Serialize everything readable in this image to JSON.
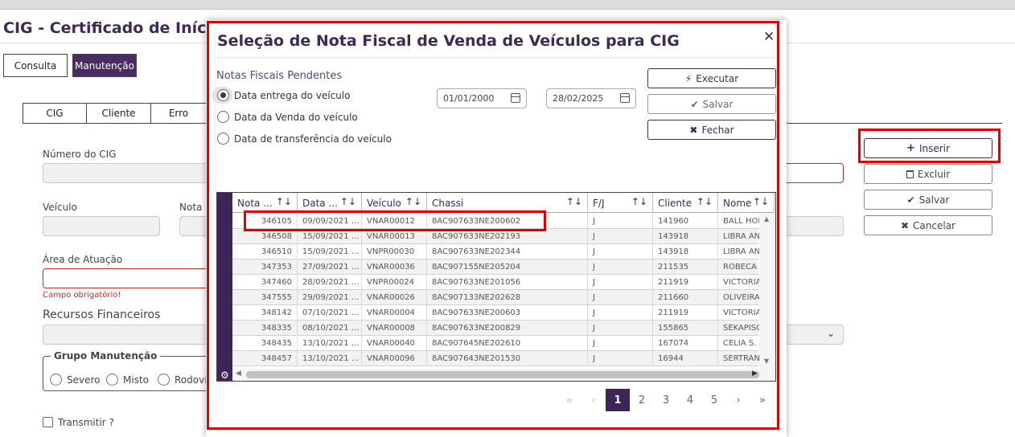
{
  "app": {
    "title": "CIG - Certificado de Início de",
    "tabs": [
      "Consulta",
      "Manutenção"
    ],
    "subtabs": [
      "CIG",
      "Cliente",
      "Erro"
    ],
    "labels": {
      "numero_cig": "Número do CIG",
      "veiculo": "Veículo",
      "nota": "Nota F",
      "area": "Área de Atuação",
      "campo_obrigatorio": "Campo obrigatório!",
      "recursos": "Recursos Financeiros",
      "grupo": "Grupo Manutenção",
      "transmitir": "Transmitir ?"
    },
    "grupo_options": [
      "Severo",
      "Misto",
      "Rodovi"
    ],
    "side_buttons": {
      "inserir": "Inserir",
      "excluir": "Excluir",
      "salvar": "Salvar",
      "cancelar": "Cancelar"
    }
  },
  "modal": {
    "title": "Seleção de Nota Fiscal de Venda de Veículos para CIG",
    "section_label": "Notas Fiscais Pendentes",
    "radio_options": [
      "Data entrega do veículo",
      "Data da Venda do veículo",
      "Data de transferência do veículo"
    ],
    "selected_option": "Data entrega do veículo",
    "date_from": "01/01/2000",
    "date_to": "28/02/2025",
    "buttons": {
      "executar": "Executar",
      "salvar": "Salvar",
      "fechar": "Fechar"
    },
    "columns": [
      "Nota ...",
      "Data ...",
      "Veículo",
      "Chassi",
      "F/J",
      "Cliente",
      "Nome"
    ],
    "rows": [
      [
        "346105",
        "09/09/2021 ...",
        "VNAR00012",
        "8AC907633NE200602",
        "J",
        "141960",
        "BALL HORT"
      ],
      [
        "346508",
        "15/09/2021 ...",
        "VNAR00013",
        "8AC907633NE202193",
        "J",
        "143918",
        "LIBRA AND"
      ],
      [
        "346510",
        "15/09/2021 ...",
        "VNPR00030",
        "8AC907633NE202344",
        "J",
        "143918",
        "LIBRA AND"
      ],
      [
        "347353",
        "27/09/2021 ...",
        "VNAR00036",
        "8AC907155NE205204",
        "J",
        "211535",
        "ROBECA P."
      ],
      [
        "347460",
        "28/09/2021 ...",
        "VNPR00024",
        "8AC907633NE201056",
        "J",
        "211919",
        "VICTORIA S"
      ],
      [
        "347555",
        "29/09/2021 ...",
        "VNAR00026",
        "8AC907133NE202628",
        "J",
        "211660",
        "OLIVEIRA L"
      ],
      [
        "348142",
        "07/10/2021 ...",
        "VNAR00004",
        "8AC907633NE200603",
        "J",
        "211919",
        "VICTORIA S"
      ],
      [
        "348335",
        "08/10/2021 ...",
        "VNAR00008",
        "8AC907633NE200829",
        "J",
        "155865",
        "SEKAPISO"
      ],
      [
        "348435",
        "13/10/2021 ...",
        "VNAR00040",
        "8AC907645NE202610",
        "J",
        "167074",
        "CELIA S. Z."
      ],
      [
        "348457",
        "13/10/2021 ...",
        "VNAR00096",
        "8AC907643NE201530",
        "J",
        "16944",
        "SERTRAN"
      ]
    ],
    "pagination": {
      "first": "«",
      "prev": "‹",
      "pages": [
        "1",
        "2",
        "3",
        "4",
        "5"
      ],
      "current": "1",
      "next": "›",
      "last": "»"
    }
  },
  "icons": {
    "close": "close-icon",
    "executar": "bolt-icon",
    "salvar": "check-icon",
    "fechar": "x-icon",
    "inserir": "plus-icon",
    "excluir": "trash-icon",
    "calendar": "calendar-icon",
    "sort": "sort-icon",
    "settings": "gear-icon"
  },
  "colors": {
    "brand": "#3d2a55",
    "rail": "#3e2559",
    "highlight": "#e00000",
    "error": "#c62828"
  }
}
